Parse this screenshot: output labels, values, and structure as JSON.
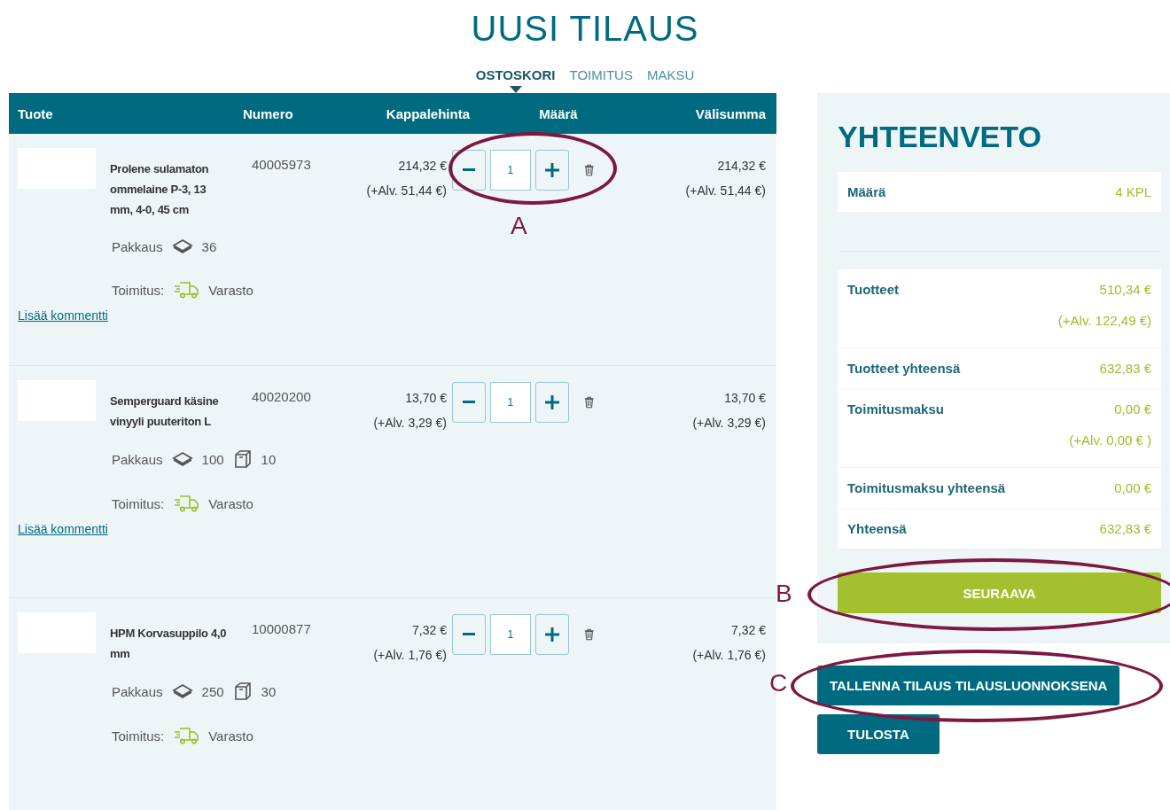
{
  "page_title": "UUSI TILAUS",
  "steps": [
    {
      "label": "OSTOSKORI",
      "selected": true
    },
    {
      "label": "TOIMITUS",
      "selected": false
    },
    {
      "label": "MAKSU",
      "selected": false
    }
  ],
  "cart": {
    "columns": [
      "Tuote",
      "Numero",
      "Kappalehinta",
      "Määrä",
      "Välisumma"
    ],
    "rows": [
      {
        "name": "Prolene sulamaton ommelaine P-3, 13 mm, 4-0, 45 cm",
        "number": "40005973",
        "unit_price": "214,32 €",
        "unit_vat": "(+Alv. 51,44 €)",
        "quantity": "1",
        "subtotal": "214,32 €",
        "subtotal_vat": "(+Alv. 51,44 €)",
        "package_label": "Pakkaus",
        "package_counts": [
          {
            "kind": "pack",
            "value": "36"
          }
        ],
        "delivery_label": "Toimitus:",
        "delivery": "Varasto",
        "comment_link": "Lisää kommentti",
        "annotation": "A"
      },
      {
        "name": "Semperguard käsine vinyyli puuteriton L",
        "number": "40020200",
        "unit_price": "13,70 €",
        "unit_vat": "(+Alv. 3,29 €)",
        "quantity": "1",
        "subtotal": "13,70 €",
        "subtotal_vat": "(+Alv. 3,29 €)",
        "package_label": "Pakkaus",
        "package_counts": [
          {
            "kind": "pack",
            "value": "100"
          },
          {
            "kind": "carton",
            "value": "10"
          }
        ],
        "delivery_label": "Toimitus:",
        "delivery": "Varasto",
        "comment_link": "Lisää kommentti"
      },
      {
        "name": "HPM Korvasuppilo 4,0 mm",
        "number": "10000877",
        "unit_price": "7,32 €",
        "unit_vat": "(+Alv. 1,76 €)",
        "quantity": "1",
        "subtotal": "7,32 €",
        "subtotal_vat": "(+Alv. 1,76 €)",
        "package_label": "Pakkaus",
        "package_counts": [
          {
            "kind": "pack",
            "value": "250"
          },
          {
            "kind": "carton",
            "value": "30"
          }
        ],
        "delivery_label": "Toimitus:",
        "delivery": "Varasto"
      }
    ]
  },
  "summary": {
    "title": "YHTEENVETO",
    "quantity": {
      "label": "Määrä",
      "value": "4 KPL"
    },
    "lines": [
      {
        "label": "Tuotteet",
        "value": "510,34 €",
        "vat": "(+Alv. 122,49 €)"
      },
      {
        "label": "Tuotteet yhteensä",
        "value": "632,83 €"
      },
      {
        "label": "Toimitusmaksu",
        "value": "0,00 €",
        "vat": "(+Alv. 0,00 € )"
      },
      {
        "label": "Toimitusmaksu yhteensä",
        "value": "0,00 €"
      },
      {
        "label": "Yhteensä",
        "value": "632,83 €"
      }
    ],
    "next_button": "SEURAAVA",
    "next_annotation": "B"
  },
  "save_button": "TALLENNA TILAUS TILAUSLUONNOKSENA",
  "save_annotation": "C",
  "print_button": "TULOSTA"
}
